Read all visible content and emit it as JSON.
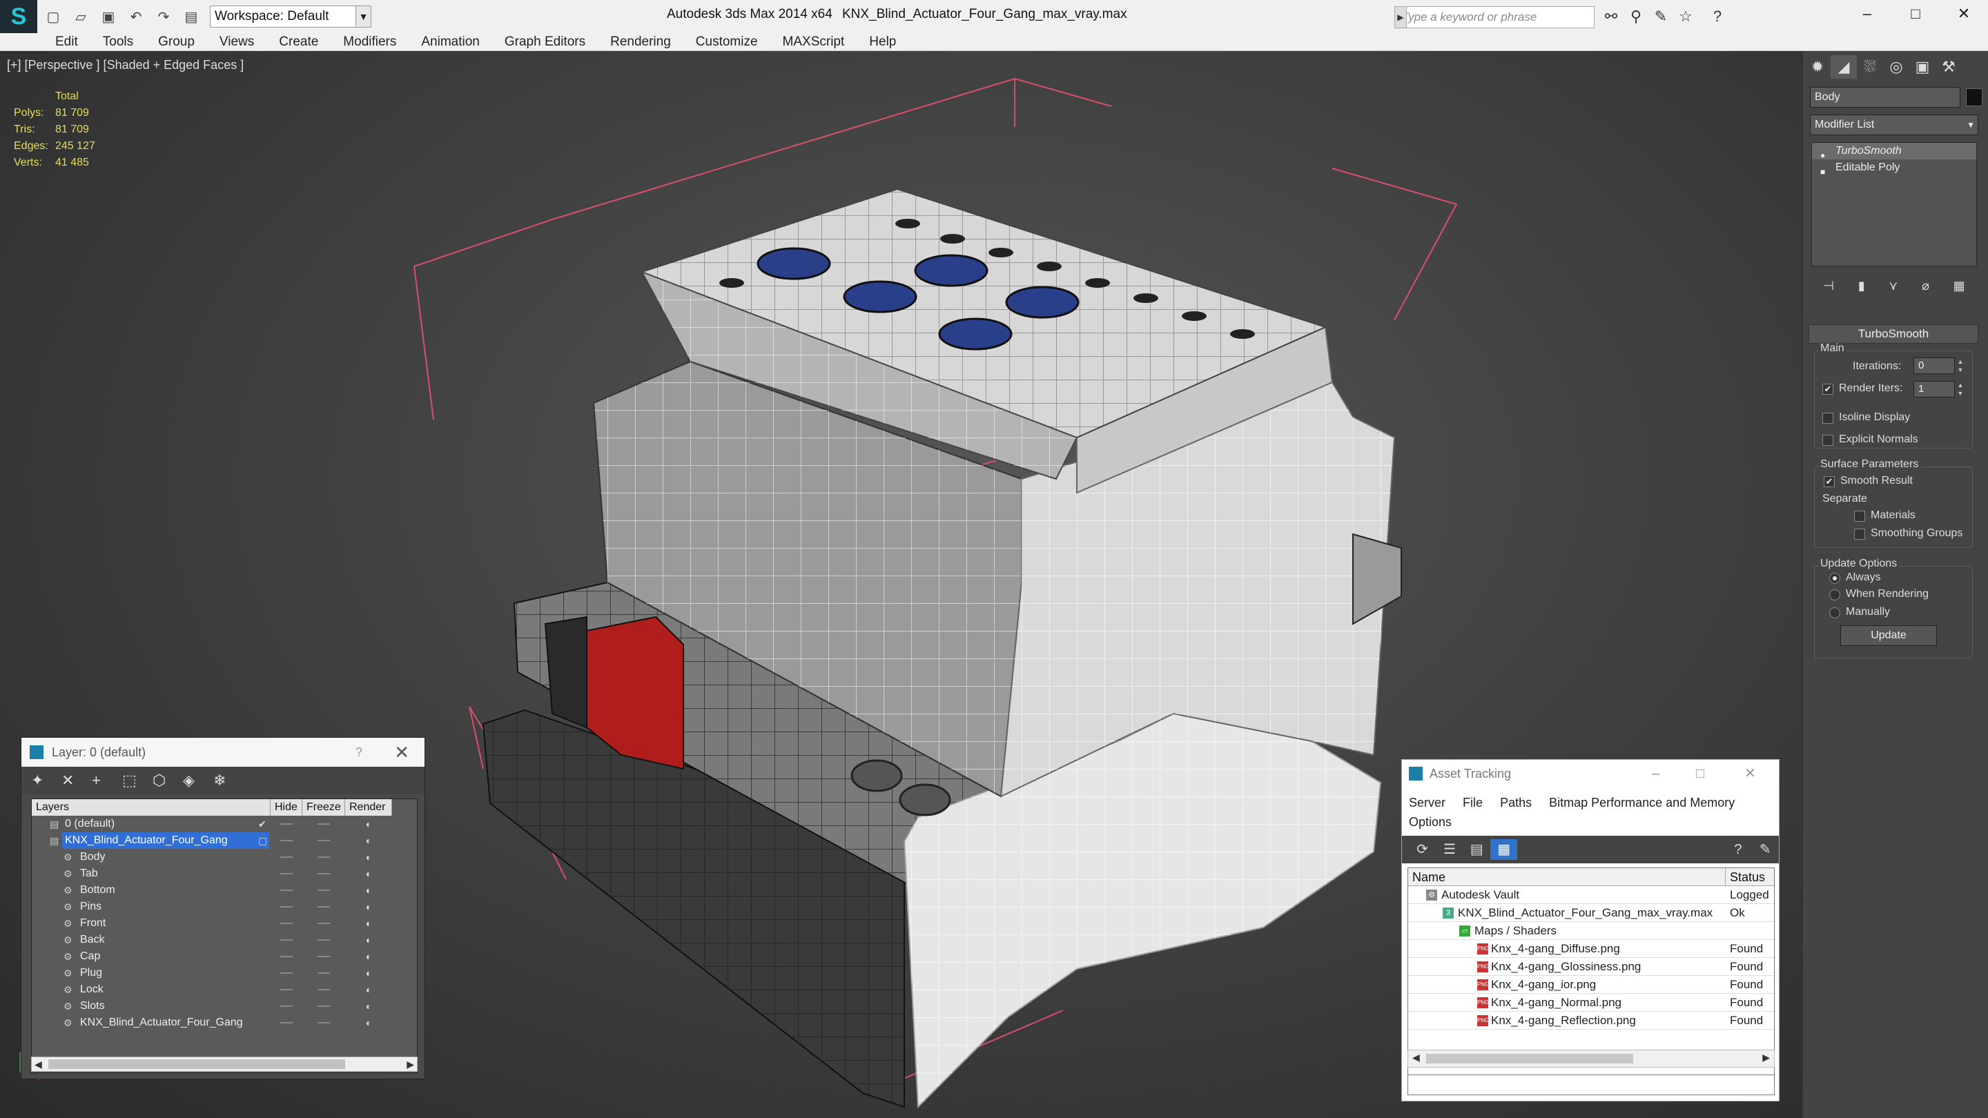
{
  "titlebar": {
    "workspace": "Workspace: Default",
    "app_title": "Autodesk 3ds Max  2014 x64",
    "file_title": "KNX_Blind_Actuator_Four_Gang_max_vray.max",
    "search_placeholder": "Type a keyword or phrase"
  },
  "menu": [
    "Edit",
    "Tools",
    "Group",
    "Views",
    "Create",
    "Modifiers",
    "Animation",
    "Graph Editors",
    "Rendering",
    "Customize",
    "MAXScript",
    "Help"
  ],
  "viewport": {
    "label": "[+] [Perspective ] [Shaded + Edged Faces ]",
    "stats_header": "Total",
    "stats": [
      {
        "k": "Polys:",
        "v": "81 709"
      },
      {
        "k": "Tris:",
        "v": "81 709"
      },
      {
        "k": "Edges:",
        "v": "245 127"
      },
      {
        "k": "Verts:",
        "v": "41 485"
      }
    ]
  },
  "command_panel": {
    "object_name": "Body",
    "modifier_list": "Modifier List",
    "stack": [
      "TurboSmooth",
      "Editable Poly"
    ],
    "rollout": "TurboSmooth",
    "main_group": "Main",
    "iterations_label": "Iterations:",
    "iterations_value": "0",
    "render_iters_label": "Render Iters:",
    "render_iters_value": "1",
    "isoline": "Isoline Display",
    "explicit_normals": "Explicit Normals",
    "surface_group": "Surface Parameters",
    "smooth_result": "Smooth Result",
    "separate": "Separate",
    "materials": "Materials",
    "smoothing_groups": "Smoothing Groups",
    "update_group": "Update Options",
    "always": "Always",
    "when_rendering": "When Rendering",
    "manually": "Manually",
    "update_btn": "Update"
  },
  "layer_dialog": {
    "title": "Layer: 0 (default)",
    "help": "?",
    "cols": [
      "Layers",
      "Hide",
      "Freeze",
      "Render"
    ],
    "rows": [
      "0 (default)",
      "KNX_Blind_Actuator_Four_Gang",
      "Body",
      "Tab",
      "Bottom",
      "Pins",
      "Front",
      "Back",
      "Cap",
      "Plug",
      "Lock",
      "Slots",
      "KNX_Blind_Actuator_Four_Gang"
    ]
  },
  "asset_dialog": {
    "title": "Asset Tracking",
    "menu1": [
      "Server",
      "File",
      "Paths",
      "Bitmap Performance and Memory"
    ],
    "menu2": [
      "Options"
    ],
    "cols": [
      "Name",
      "Status"
    ],
    "rows": [
      {
        "name": "Autodesk Vault",
        "status": "Logged"
      },
      {
        "name": "KNX_Blind_Actuator_Four_Gang_max_vray.max",
        "status": "Ok"
      },
      {
        "name": "Maps / Shaders",
        "status": ""
      },
      {
        "name": "Knx_4-gang_Diffuse.png",
        "status": "Found"
      },
      {
        "name": "Knx_4-gang_Glossiness.png",
        "status": "Found"
      },
      {
        "name": "Knx_4-gang_ior.png",
        "status": "Found"
      },
      {
        "name": "Knx_4-gang_Normal.png",
        "status": "Found"
      },
      {
        "name": "Knx_4-gang_Reflection.png",
        "status": "Found"
      }
    ],
    "icon_png": "PNG",
    "icon_max": "3"
  }
}
